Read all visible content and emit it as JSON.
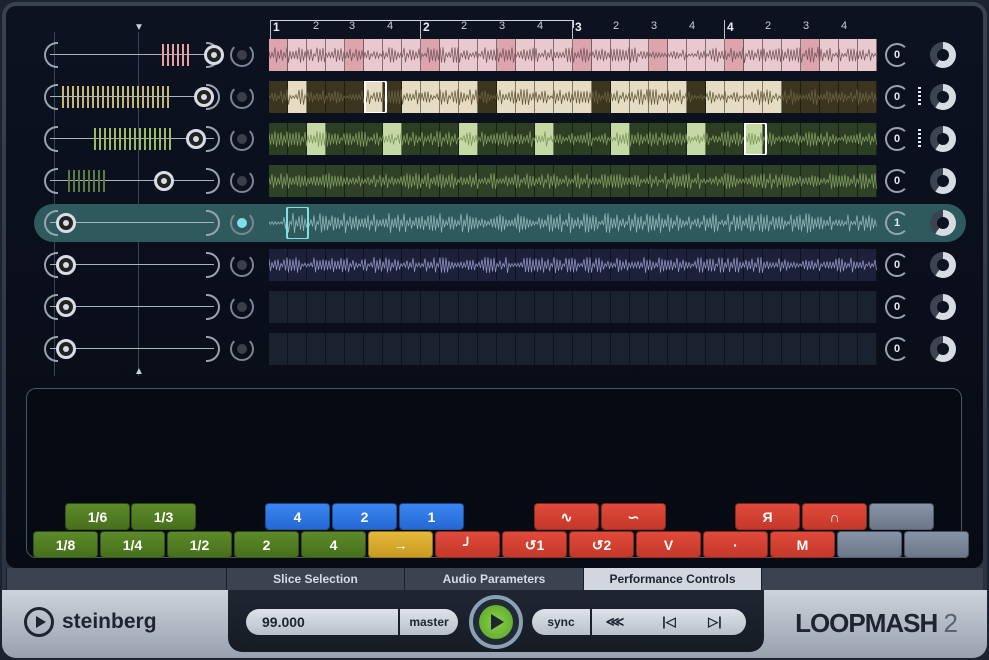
{
  "ruler": {
    "ticks": [
      "1",
      "2",
      "3",
      "4",
      "2",
      "2",
      "3",
      "4",
      "3",
      "2",
      "3",
      "4",
      "4",
      "2",
      "3",
      "4"
    ]
  },
  "tracks": [
    {
      "id": 1,
      "value": "0",
      "color": "#e9c9cd",
      "dark": "#c9a6ab",
      "pattern": "pink",
      "selected": false
    },
    {
      "id": 2,
      "value": "0",
      "color": "#e6dcc3",
      "dark": "#c6b896",
      "pattern": "cream",
      "selected": false
    },
    {
      "id": 3,
      "value": "0",
      "color": "#c4d9a3",
      "dark": "#3a4f2c",
      "pattern": "green",
      "selected": false
    },
    {
      "id": 4,
      "value": "0",
      "color": "#3d5233",
      "dark": "#2f4127",
      "pattern": "darkgreen",
      "selected": false
    },
    {
      "id": 5,
      "value": "1",
      "color": "#2e5a5e",
      "dark": "#1d3a3d",
      "pattern": "teal",
      "selected": true
    },
    {
      "id": 6,
      "value": "0",
      "color": "#252a48",
      "dark": "#1c2039",
      "pattern": "navy",
      "selected": false
    },
    {
      "id": 7,
      "value": "0",
      "color": "#1f2838",
      "dark": "#1a2230",
      "pattern": "empty",
      "selected": false
    },
    {
      "id": 8,
      "value": "0",
      "color": "#1f2838",
      "dark": "#1a2230",
      "pattern": "empty",
      "selected": false
    }
  ],
  "performance": {
    "top_row": [
      {
        "label": "1/6",
        "color": "green"
      },
      {
        "label": "1/3",
        "color": "green"
      },
      {
        "label": "4",
        "color": "blue"
      },
      {
        "label": "2",
        "color": "blue"
      },
      {
        "label": "1",
        "color": "blue"
      },
      {
        "label": "∿",
        "color": "red"
      },
      {
        "label": "∽",
        "color": "red"
      },
      {
        "label": "Я",
        "color": "red"
      },
      {
        "label": "∩",
        "color": "red"
      },
      {
        "label": "",
        "color": "gray"
      }
    ],
    "bottom_row": [
      {
        "label": "1/8",
        "color": "green"
      },
      {
        "label": "1/4",
        "color": "green"
      },
      {
        "label": "1/2",
        "color": "green"
      },
      {
        "label": "2",
        "color": "green"
      },
      {
        "label": "4",
        "color": "green"
      },
      {
        "label": "→",
        "color": "yellow"
      },
      {
        "label": "╯",
        "color": "red"
      },
      {
        "label": "↺1",
        "color": "red"
      },
      {
        "label": "↺2",
        "color": "red"
      },
      {
        "label": "V",
        "color": "red"
      },
      {
        "label": "·",
        "color": "red"
      },
      {
        "label": "M",
        "color": "red"
      },
      {
        "label": "",
        "color": "gray"
      },
      {
        "label": "",
        "color": "gray"
      }
    ]
  },
  "tabs": [
    "",
    "Slice Selection",
    "Audio Parameters",
    "Performance Controls",
    ""
  ],
  "active_tab": "Performance Controls",
  "footer": {
    "brand": "steinberg",
    "tempo": "99.000",
    "master_label": "master",
    "sync_label": "sync",
    "nav": [
      "⋘",
      "|◁",
      "▷|"
    ],
    "product_a": "LOOPMASH",
    "product_b": " 2"
  }
}
